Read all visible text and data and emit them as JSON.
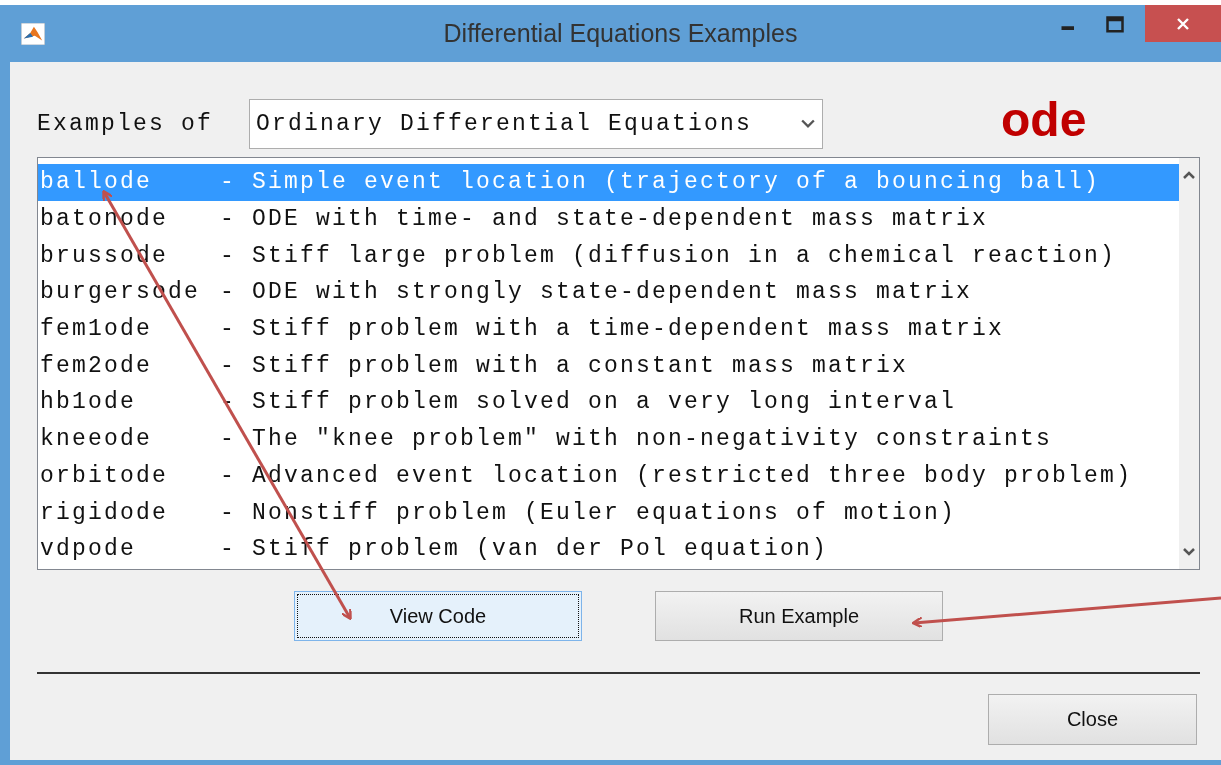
{
  "window": {
    "title": "Differential Equations Examples"
  },
  "examples_label": "Examples of",
  "dropdown": {
    "value": "Ordinary Differential Equations"
  },
  "annotation": "ode",
  "examples": [
    {
      "name": "ballode",
      "description": "- Simple event location (trajectory of a bouncing ball)",
      "selected": true
    },
    {
      "name": "batonode",
      "description": "- ODE with time- and state-dependent mass matrix",
      "selected": false
    },
    {
      "name": "brussode",
      "description": "- Stiff large problem (diffusion in a chemical reaction)",
      "selected": false
    },
    {
      "name": "burgersode",
      "description": "- ODE with strongly state-dependent mass matrix",
      "selected": false
    },
    {
      "name": "fem1ode",
      "description": "- Stiff problem with a time-dependent mass matrix",
      "selected": false
    },
    {
      "name": "fem2ode",
      "description": "- Stiff problem with a constant mass matrix",
      "selected": false
    },
    {
      "name": "hb1ode",
      "description": "- Stiff problem solved on a very long interval",
      "selected": false
    },
    {
      "name": "kneeode",
      "description": "- The \"knee problem\" with non-negativity constraints",
      "selected": false
    },
    {
      "name": "orbitode",
      "description": "- Advanced event location (restricted three body problem)",
      "selected": false
    },
    {
      "name": "rigidode",
      "description": "- Nonstiff problem (Euler equations of motion)",
      "selected": false
    },
    {
      "name": "vdpode",
      "description": "- Stiff problem (van der Pol equation)",
      "selected": false
    }
  ],
  "action_buttons": [
    {
      "label": "View Code",
      "focused": true
    },
    {
      "label": "Run Example",
      "focused": false
    }
  ],
  "close_button": {
    "label": "Close"
  }
}
